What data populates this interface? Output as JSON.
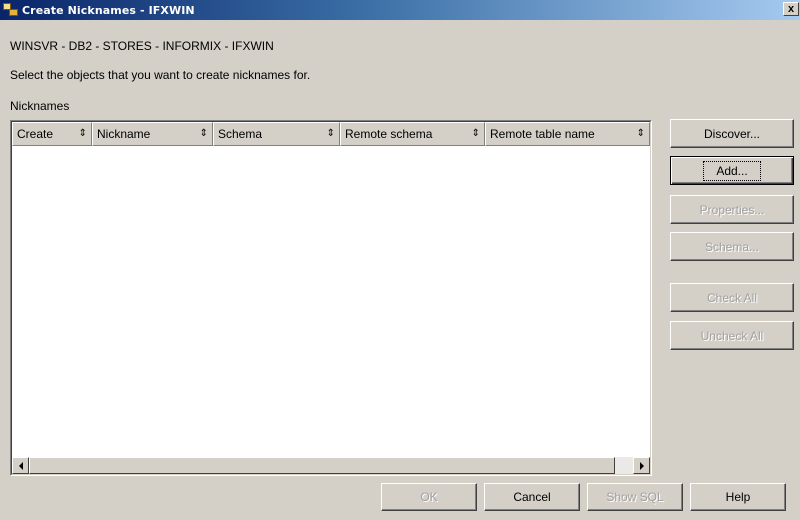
{
  "window": {
    "title": "Create Nicknames - IFXWIN",
    "close_label": "x"
  },
  "path_text": "WINSVR - DB2 - STORES - INFORMIX - IFXWIN",
  "instruction": "Select the objects that you want to create nicknames for.",
  "nicknames_label": "Nicknames",
  "table": {
    "columns": [
      {
        "label": "Create"
      },
      {
        "label": "Nickname"
      },
      {
        "label": "Schema"
      },
      {
        "label": "Remote schema"
      },
      {
        "label": "Remote table name"
      }
    ],
    "sort_icon": "⇕",
    "rows": []
  },
  "side_buttons": {
    "discover": "Discover...",
    "add": "Add...",
    "properties": "Properties...",
    "schema": "Schema...",
    "check_all": "Check All",
    "uncheck_all": "Uncheck All"
  },
  "footer_buttons": {
    "ok": "OK",
    "cancel": "Cancel",
    "show_sql": "Show SQL",
    "help": "Help"
  },
  "colors": {
    "dialog_bg": "#d4d0c8",
    "title_gradient_start": "#0a246a",
    "title_gradient_end": "#a6caf0"
  }
}
